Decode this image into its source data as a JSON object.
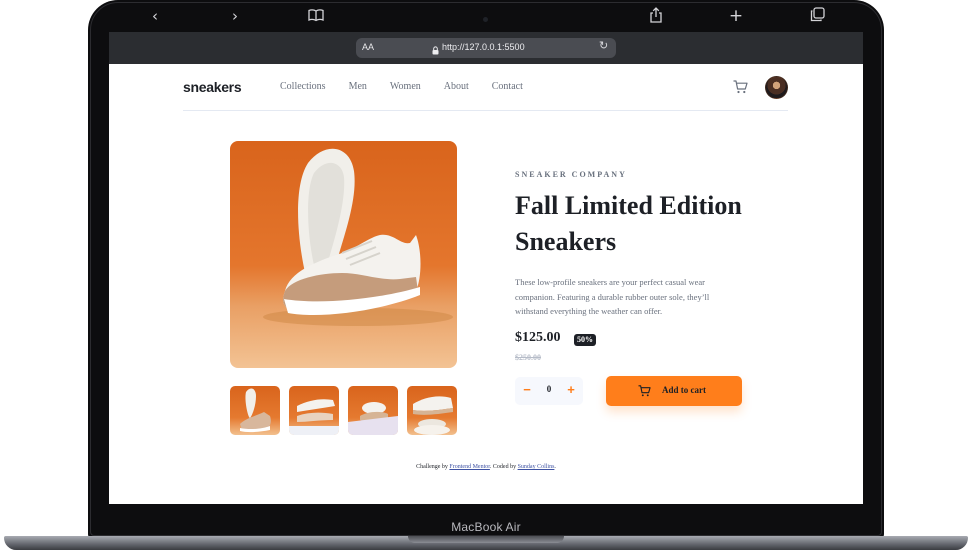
{
  "device": {
    "label": "MacBook Air"
  },
  "browser": {
    "text_size_label": "AA",
    "url": "http://127.0.0.1:5500",
    "icons": [
      "chevron-left-icon",
      "chevron-right-icon",
      "book-icon",
      "lock-icon",
      "reload-icon",
      "share-icon",
      "plus-icon",
      "tabs-icon"
    ]
  },
  "header": {
    "logo": "sneakers",
    "nav": [
      "Collections",
      "Men",
      "Women",
      "About",
      "Contact"
    ]
  },
  "product": {
    "company": "SNEAKER COMPANY",
    "title": "Fall Limited Edition Sneakers",
    "description": "These low-profile sneakers are your perfect casual wear companion. Featuring a durable rubber outer sole, they’ll withstand everything the weather can offer.",
    "price": "$125.00",
    "discount": "50%",
    "original_price": "$250.00",
    "quantity": "0",
    "minus_label": "−",
    "plus_label": "+",
    "add_to_cart": "Add to cart"
  },
  "footer": {
    "challenge_prefix": "Challenge by",
    "challenge_link": "Frontend Mentor",
    "coded_prefix": ". Coded by",
    "coded_link": "Sunday Collins",
    "suffix": "."
  },
  "colors": {
    "accent": "#ff7e1b",
    "dark": "#1d2026",
    "muted": "#69707d",
    "toolbar": "#2b2d31"
  }
}
